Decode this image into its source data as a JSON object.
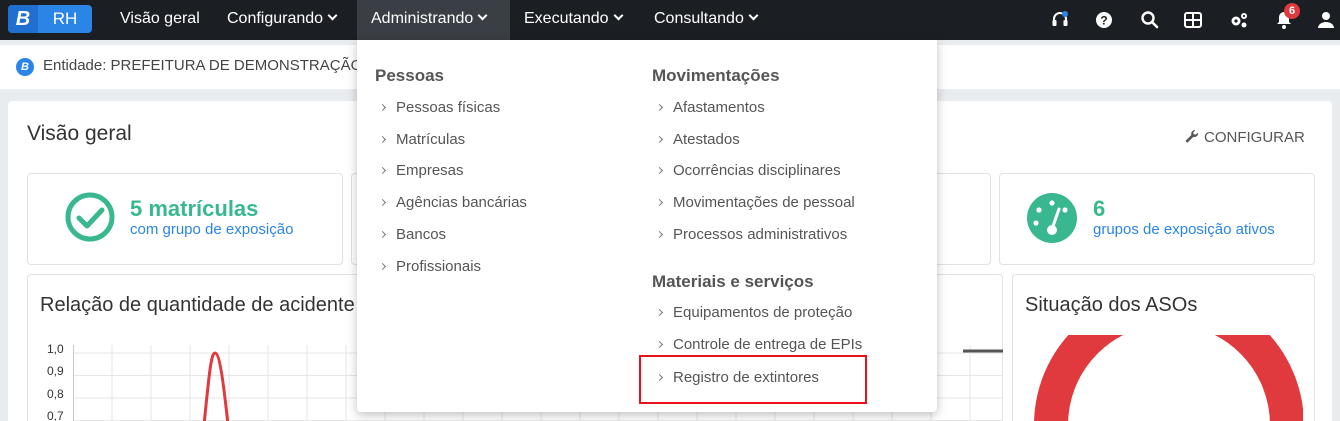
{
  "nav": {
    "logo_b": "B",
    "logo_rh": "RH",
    "items": [
      {
        "label": "Visão geral",
        "dropdown": false
      },
      {
        "label": "Configurando",
        "dropdown": true
      },
      {
        "label": "Administrando",
        "dropdown": true,
        "active": true
      },
      {
        "label": "Executando",
        "dropdown": true
      },
      {
        "label": "Consultando",
        "dropdown": true
      }
    ],
    "icons": [
      "support-icon",
      "help-icon",
      "search-icon",
      "apps-grid-icon",
      "settings-icon",
      "notifications-icon",
      "user-icon"
    ],
    "notification_count": "6"
  },
  "entity": {
    "icon_letter": "B",
    "label": "Entidade: PREFEITURA DE DEMONSTRAÇÃO"
  },
  "page": {
    "title": "Visão geral",
    "configure_label": "CONFIGURAR"
  },
  "cards": {
    "matriculas": {
      "value": "5 matrículas",
      "caption": "com grupo de exposição"
    },
    "grupos": {
      "value": "6",
      "caption": "grupos de exposição ativos"
    }
  },
  "charts": {
    "acidentes_title": "Relação de quantidade de acidente",
    "asos_title": "Situação dos ASOs"
  },
  "chart_data": {
    "type": "line",
    "title": "Relação de quantidade de acidente",
    "y_ticks": [
      "1,0",
      "0,9",
      "0,8",
      "0,7"
    ],
    "ylim": [
      0.7,
      1.0
    ],
    "peak_value": 1.0
  },
  "dropdown": {
    "pessoas": {
      "heading": "Pessoas",
      "items": [
        "Pessoas físicas",
        "Matrículas",
        "Empresas",
        "Agências bancárias",
        "Bancos",
        "Profissionais"
      ]
    },
    "movimentacoes": {
      "heading": "Movimentações",
      "items": [
        "Afastamentos",
        "Atestados",
        "Ocorrências disciplinares",
        "Movimentações de pessoal",
        "Processos administrativos"
      ]
    },
    "materiais": {
      "heading": "Materiais e serviços",
      "items": [
        "Equipamentos de proteção",
        "Controle de entrega de EPIs",
        "Registro de extintores"
      ]
    }
  },
  "colors": {
    "topbar": "#1b1f24",
    "brand_blue": "#2b85e6",
    "green": "#39b88f",
    "red": "#e0393e",
    "highlight": "#e8131a"
  }
}
